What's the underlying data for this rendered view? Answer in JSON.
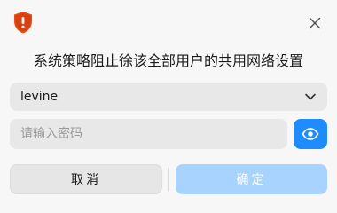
{
  "dialog": {
    "title": "系统策略阻止徐该全部用户的共用网络设置",
    "icon": "shield-warning-icon",
    "close_icon": "close-icon"
  },
  "user_select": {
    "value": "levine",
    "icon": "chevron-down-icon"
  },
  "password": {
    "value": "",
    "placeholder": "请输入密码",
    "toggle_icon": "eye-icon"
  },
  "buttons": {
    "cancel_label": "取消",
    "ok_label": "确定"
  },
  "colors": {
    "accent": "#1e8bff",
    "ok_disabled": "#a9d3ff",
    "warning": "#e84a1b",
    "background": "#f7f7f7"
  }
}
